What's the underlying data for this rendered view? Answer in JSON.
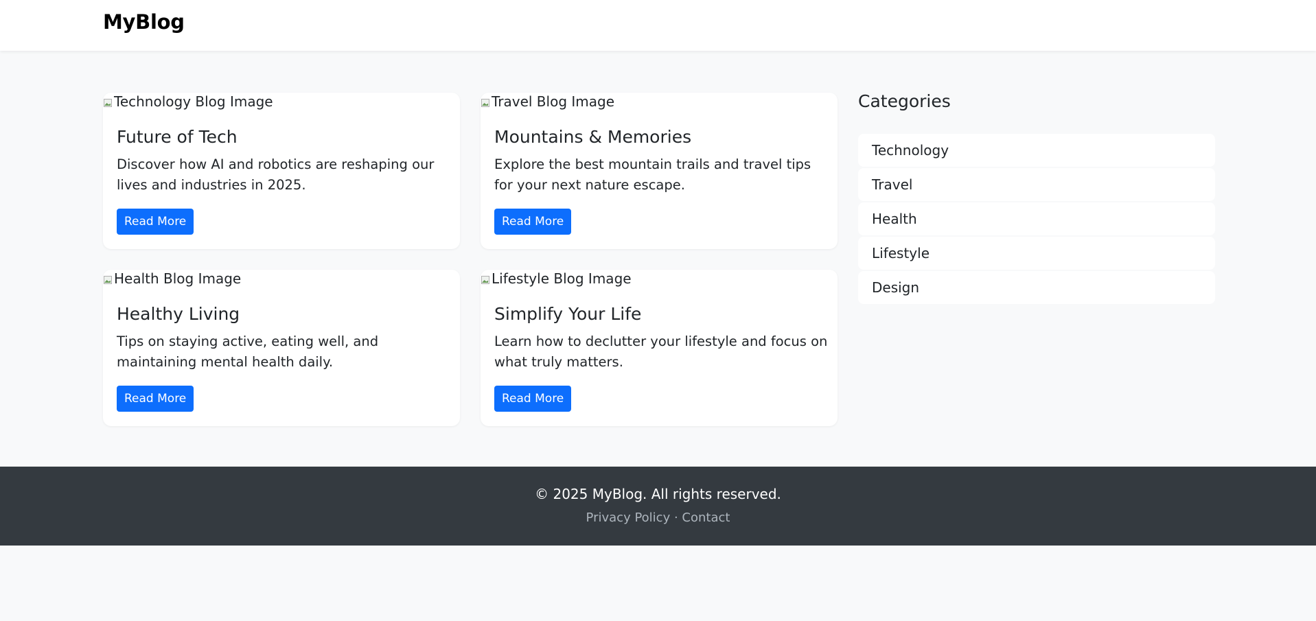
{
  "navbar": {
    "brand": "MyBlog"
  },
  "posts": [
    {
      "image_alt": "Technology Blog Image",
      "title": "Future of Tech",
      "excerpt": "Discover how AI and robotics are reshaping our lives and industries in 2025.",
      "button_label": "Read More"
    },
    {
      "image_alt": "Travel Blog Image",
      "title": "Mountains & Memories",
      "excerpt": "Explore the best mountain trails and travel tips for your next nature escape.",
      "button_label": "Read More"
    },
    {
      "image_alt": "Health Blog Image",
      "title": "Healthy Living",
      "excerpt": "Tips on staying active, eating well, and maintaining mental health daily.",
      "button_label": "Read More"
    },
    {
      "image_alt": "Lifestyle Blog Image",
      "title": "Simplify Your Life",
      "excerpt": "Learn how to declutter your lifestyle and focus on what truly matters.",
      "button_label": "Read More"
    }
  ],
  "sidebar": {
    "heading": "Categories",
    "items": [
      "Technology",
      "Travel",
      "Health",
      "Lifestyle",
      "Design"
    ]
  },
  "footer": {
    "copyright": "© 2025 MyBlog. All rights reserved.",
    "links": [
      "Privacy Policy",
      "Contact"
    ],
    "separator": "·"
  },
  "colors": {
    "accent": "#0d6efd",
    "page_background": "#f8f9fa",
    "footer_background": "#343a40"
  }
}
